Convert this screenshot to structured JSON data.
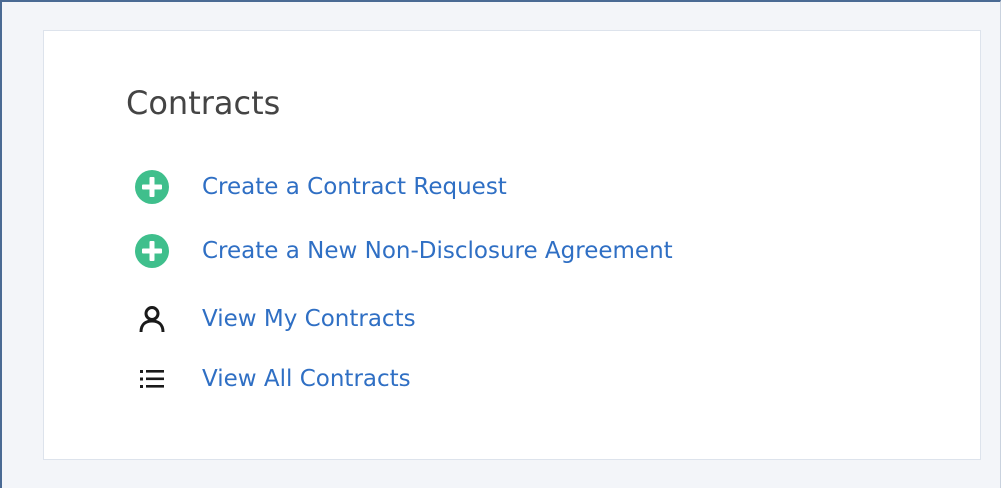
{
  "card": {
    "title": "Contracts",
    "actions": [
      {
        "label": "Create a Contract Request",
        "icon": "add-circle-icon"
      },
      {
        "label": "Create a New Non-Disclosure Agreement",
        "icon": "add-circle-icon"
      },
      {
        "label": "View My Contracts",
        "icon": "person-icon"
      },
      {
        "label": "View All Contracts",
        "icon": "list-icon"
      }
    ]
  },
  "colors": {
    "page_background": "#f3f5f9",
    "card_background": "#ffffff",
    "link": "#2f6fc4",
    "add_icon": "#3fbf8c",
    "title_text": "#444444"
  }
}
